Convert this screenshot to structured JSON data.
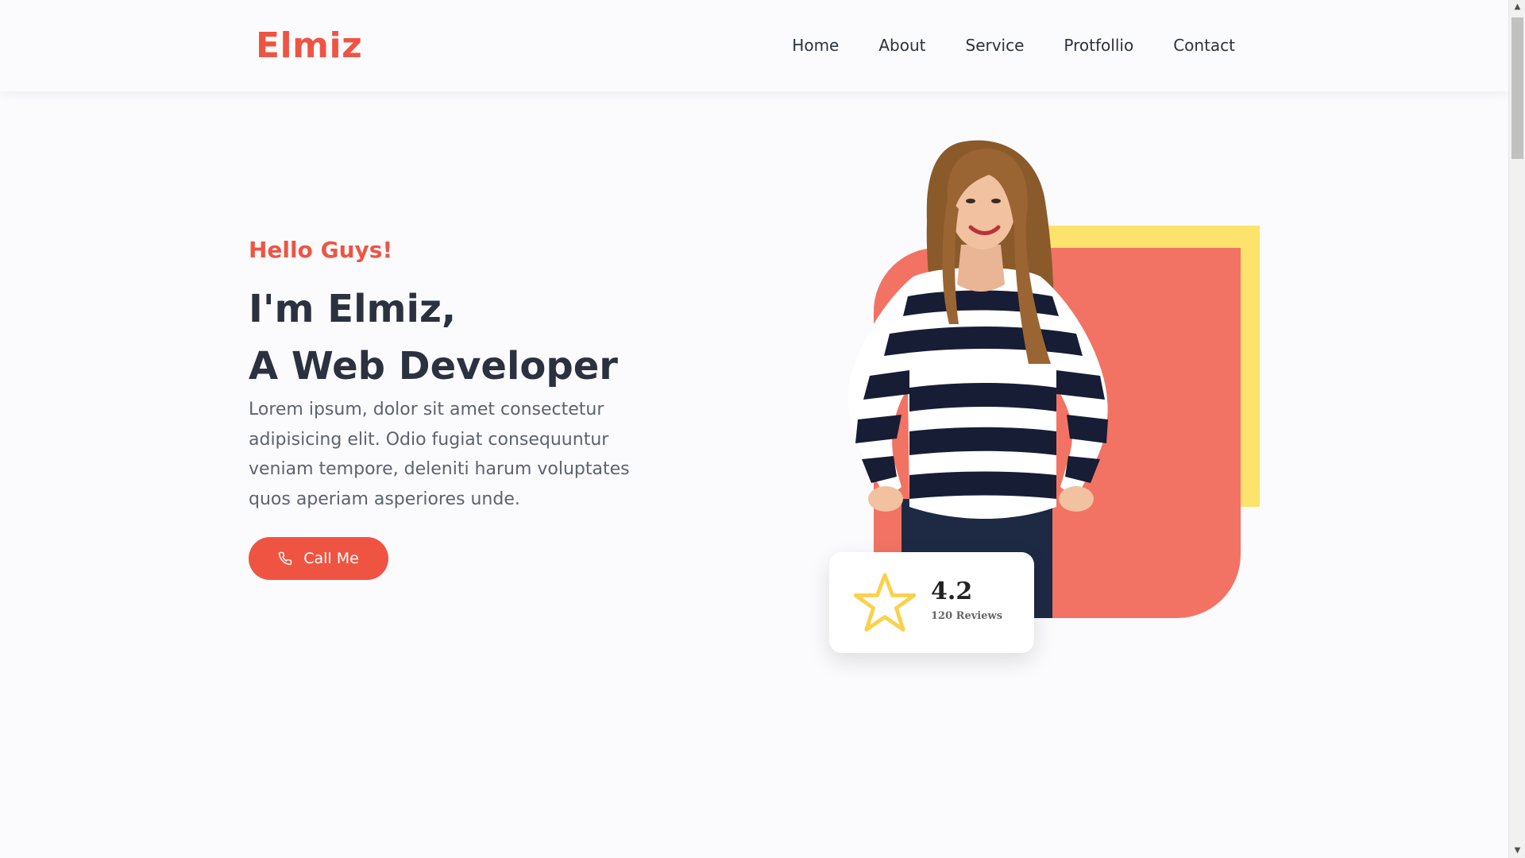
{
  "brand": {
    "logo": "Elmiz",
    "accent_color": "#ef5443",
    "dark_text_color": "#2c3140"
  },
  "nav": {
    "items": [
      {
        "label": "Home"
      },
      {
        "label": "About"
      },
      {
        "label": "Service"
      },
      {
        "label": "Protfollio"
      },
      {
        "label": "Contact"
      }
    ]
  },
  "hero": {
    "greeting": "Hello Guys!",
    "headline_line1": "I'm Elmiz,",
    "headline_line2": "A Web Developer",
    "description": "Lorem ipsum, dolor sit amet consectetur adipisicing elit. Odio fugiat consequuntur veniam tempore, deleniti harum voluptates quos aperiam asperiores unde.",
    "cta_label": "Call Me",
    "cta_icon": "phone-icon"
  },
  "visual": {
    "shape_colors": {
      "yellow": "#fde26b",
      "red": "#f27363"
    },
    "person_image": "woman-in-striped-sweater"
  },
  "review_card": {
    "icon": "star-outline-icon",
    "rating": "4.2",
    "reviews_label": "120 Reviews"
  }
}
